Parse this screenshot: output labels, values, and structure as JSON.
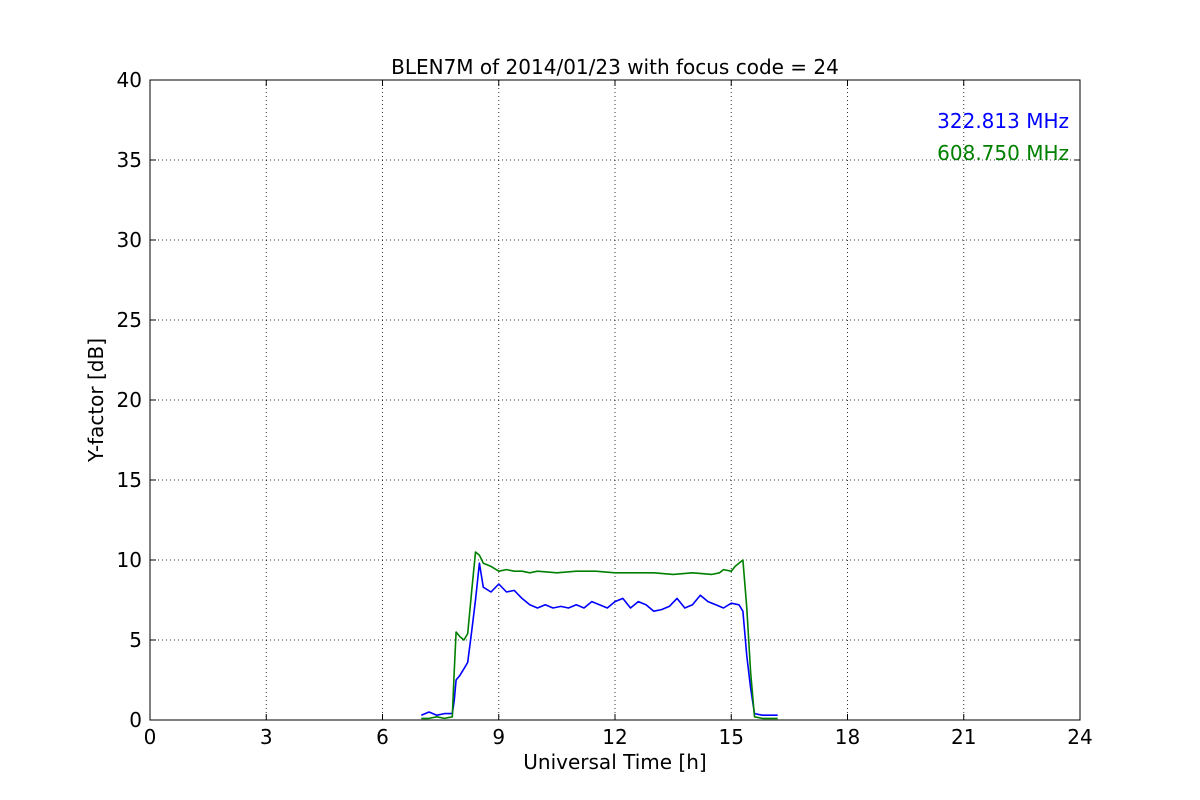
{
  "chart_data": {
    "type": "line",
    "title": "BLEN7M of 2014/01/23 with focus code = 24",
    "xlabel": "Universal Time [h]",
    "ylabel": "Y-factor [dB]",
    "xlim": [
      0,
      24
    ],
    "ylim": [
      0,
      40
    ],
    "xticks": [
      0,
      3,
      6,
      9,
      12,
      15,
      18,
      21,
      24
    ],
    "yticks": [
      0,
      5,
      10,
      15,
      20,
      25,
      30,
      35,
      40
    ],
    "grid": true,
    "legend_position": "top-right",
    "series": [
      {
        "name": "322.813 MHz",
        "color": "#0000ff",
        "points": [
          [
            7.0,
            0.3
          ],
          [
            7.2,
            0.5
          ],
          [
            7.4,
            0.3
          ],
          [
            7.6,
            0.4
          ],
          [
            7.8,
            0.4
          ],
          [
            7.85,
            1.2
          ],
          [
            7.9,
            2.5
          ],
          [
            8.0,
            2.8
          ],
          [
            8.1,
            3.2
          ],
          [
            8.2,
            3.6
          ],
          [
            8.3,
            5.5
          ],
          [
            8.4,
            7.5
          ],
          [
            8.5,
            9.8
          ],
          [
            8.6,
            8.3
          ],
          [
            8.8,
            8.0
          ],
          [
            9.0,
            8.5
          ],
          [
            9.2,
            8.0
          ],
          [
            9.4,
            8.1
          ],
          [
            9.6,
            7.6
          ],
          [
            9.8,
            7.2
          ],
          [
            10.0,
            7.0
          ],
          [
            10.2,
            7.2
          ],
          [
            10.4,
            7.0
          ],
          [
            10.6,
            7.1
          ],
          [
            10.8,
            7.0
          ],
          [
            11.0,
            7.2
          ],
          [
            11.2,
            7.0
          ],
          [
            11.4,
            7.4
          ],
          [
            11.6,
            7.2
          ],
          [
            11.8,
            7.0
          ],
          [
            12.0,
            7.4
          ],
          [
            12.2,
            7.6
          ],
          [
            12.4,
            7.0
          ],
          [
            12.6,
            7.4
          ],
          [
            12.8,
            7.2
          ],
          [
            13.0,
            6.8
          ],
          [
            13.2,
            6.9
          ],
          [
            13.4,
            7.1
          ],
          [
            13.6,
            7.6
          ],
          [
            13.8,
            7.0
          ],
          [
            14.0,
            7.2
          ],
          [
            14.2,
            7.8
          ],
          [
            14.4,
            7.4
          ],
          [
            14.6,
            7.2
          ],
          [
            14.8,
            7.0
          ],
          [
            15.0,
            7.3
          ],
          [
            15.2,
            7.2
          ],
          [
            15.3,
            6.8
          ],
          [
            15.4,
            4.0
          ],
          [
            15.5,
            2.0
          ],
          [
            15.6,
            0.4
          ],
          [
            15.8,
            0.3
          ],
          [
            16.0,
            0.3
          ],
          [
            16.2,
            0.3
          ]
        ]
      },
      {
        "name": "608.750 MHz",
        "color": "#008000",
        "points": [
          [
            7.0,
            0.1
          ],
          [
            7.2,
            0.1
          ],
          [
            7.4,
            0.2
          ],
          [
            7.6,
            0.1
          ],
          [
            7.8,
            0.2
          ],
          [
            7.85,
            3.0
          ],
          [
            7.9,
            5.5
          ],
          [
            8.0,
            5.2
          ],
          [
            8.1,
            5.0
          ],
          [
            8.2,
            5.4
          ],
          [
            8.3,
            8.0
          ],
          [
            8.4,
            10.5
          ],
          [
            8.5,
            10.3
          ],
          [
            8.6,
            9.8
          ],
          [
            8.8,
            9.6
          ],
          [
            9.0,
            9.3
          ],
          [
            9.2,
            9.4
          ],
          [
            9.4,
            9.3
          ],
          [
            9.6,
            9.3
          ],
          [
            9.8,
            9.2
          ],
          [
            10.0,
            9.3
          ],
          [
            10.5,
            9.2
          ],
          [
            11.0,
            9.3
          ],
          [
            11.5,
            9.3
          ],
          [
            12.0,
            9.2
          ],
          [
            12.5,
            9.2
          ],
          [
            13.0,
            9.2
          ],
          [
            13.5,
            9.1
          ],
          [
            14.0,
            9.2
          ],
          [
            14.5,
            9.1
          ],
          [
            14.7,
            9.2
          ],
          [
            14.8,
            9.4
          ],
          [
            15.0,
            9.3
          ],
          [
            15.1,
            9.6
          ],
          [
            15.3,
            10.0
          ],
          [
            15.4,
            7.0
          ],
          [
            15.5,
            3.0
          ],
          [
            15.6,
            0.2
          ],
          [
            15.8,
            0.1
          ],
          [
            16.0,
            0.1
          ],
          [
            16.2,
            0.1
          ]
        ]
      }
    ]
  }
}
